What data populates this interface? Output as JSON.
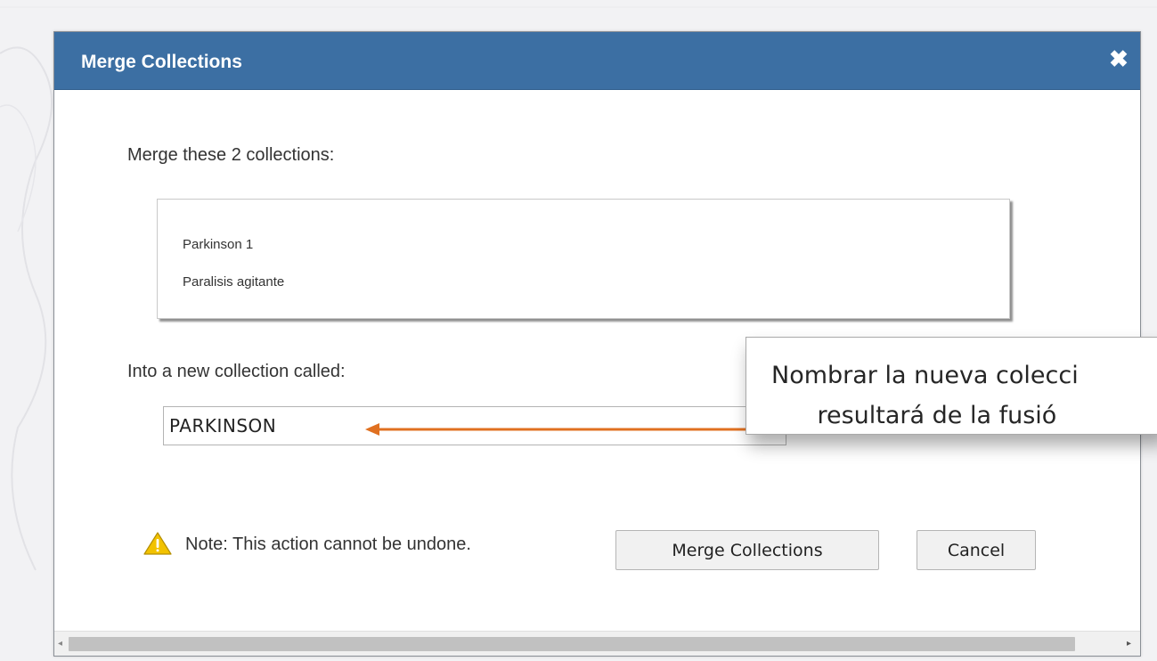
{
  "dialog": {
    "title": "Merge Collections",
    "close_glyph": "✖",
    "merge_label": "Merge these 2 collections:",
    "collections": [
      "Parkinson 1",
      "Paralisis agitante"
    ],
    "into_label": "Into a new collection called:",
    "name_value": "PARKINSON",
    "note": "Note: This action cannot be undone.",
    "merge_button": "Merge Collections",
    "cancel_button": "Cancel",
    "colors": {
      "titlebar": "#3c6fa3",
      "warning": "#f2c200"
    }
  },
  "callout": {
    "text": "Nombrar la nueva colecci\n      resultará de la fusió",
    "arrow_color": "#e07020"
  }
}
